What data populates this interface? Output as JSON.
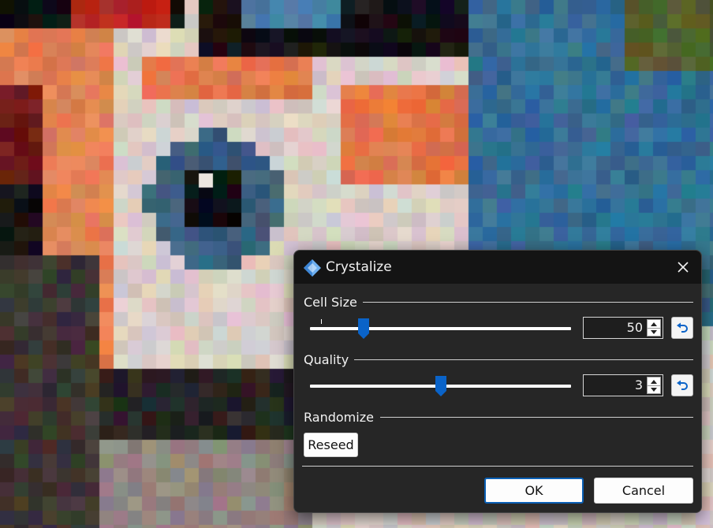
{
  "dialog": {
    "title": "Crystalize",
    "cell_size": {
      "label": "Cell Size",
      "value": "50",
      "slider_fraction": 0.206
    },
    "quality": {
      "label": "Quality",
      "value": "3",
      "slider_fraction": 0.5
    },
    "randomize": {
      "label": "Randomize",
      "reseed_label": "Reseed"
    },
    "ok_label": "OK",
    "cancel_label": "Cancel"
  },
  "icons": {
    "app": "crystal-diamond-icon",
    "close": "close-icon",
    "reset": "undo-arrow-icon"
  },
  "colors": {
    "accent": "#0a63c8",
    "dialog_bg": "#262626",
    "titlebar_bg": "#141414"
  }
}
